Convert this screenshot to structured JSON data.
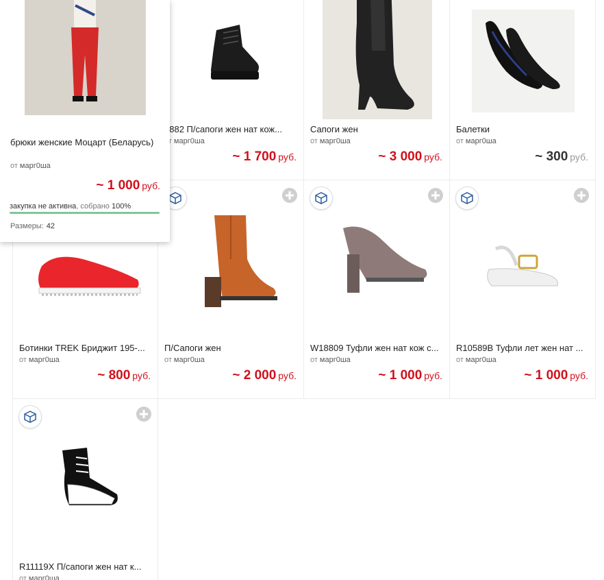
{
  "cards": [
    {
      "title": "",
      "seller": "марг0ша",
      "price": "",
      "currency": ""
    },
    {
      "title": "9882 П/сапоги жен нат кож...",
      "seller": "марг0ша",
      "price": "~ 1 700",
      "currency": "руб."
    },
    {
      "title": "Сапоги жен",
      "seller": "марг0ша",
      "price": "~ 3 000",
      "currency": "руб."
    },
    {
      "title": "Балетки",
      "seller": "марг0ша",
      "price": "~ 300",
      "currency": "руб."
    },
    {
      "title": "Ботинки TREK Бриджит 195-...",
      "seller": "марг0ша",
      "price": "~ 800",
      "currency": "руб."
    },
    {
      "title": "П/Сапоги жен",
      "seller": "марг0ша",
      "price": "~ 2 000",
      "currency": "руб."
    },
    {
      "title": "W18809 Туфли жен нат кож с...",
      "seller": "марг0ша",
      "price": "~ 1 000",
      "currency": "руб."
    },
    {
      "title": "R10589B Туфли лет жен нат ...",
      "seller": "марг0ша",
      "price": "~ 1 000",
      "currency": "руб."
    },
    {
      "title": "R11119X П/сапоги жен нат к...",
      "seller": "марг0ша",
      "price": "",
      "currency": ""
    }
  ],
  "seller_prefix": "от",
  "popup": {
    "title": "брюки женские Моцарт (Беларусь)",
    "seller_prefix": "от",
    "seller": "марг0ша",
    "price": "~ 1 000",
    "currency": "руб.",
    "status_text": "закупка не активна",
    "collected_label": ", собрано",
    "collected_value": "100%",
    "collected_fraction": 1.0,
    "sizes_label": "Размеры:",
    "sizes_value": "42"
  },
  "icons": {
    "box": "package-box-icon",
    "plus": "add-plus-icon"
  },
  "colors": {
    "price": "#d0101b",
    "progress": "#7fc79b",
    "box_icon": "#2a5d9f"
  }
}
